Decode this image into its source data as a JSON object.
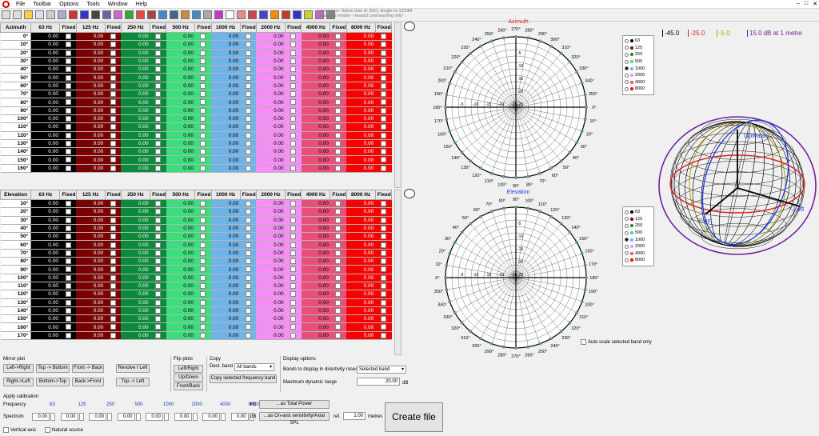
{
  "menu": {
    "items": [
      "File",
      "Toolbar",
      "Options",
      "Tools",
      "Window",
      "Help"
    ],
    "window_buttons": [
      "–",
      "□",
      "✕"
    ]
  },
  "license_text": [
    "Licensed to: Odeon   User id: 2001, dongle no 102084",
    "Restricted version - research and teaching only!"
  ],
  "bands": [
    "63 Hz",
    "125 Hz",
    "250 Hz",
    "500 Hz",
    "1000 Hz",
    "2000 Hz",
    "4000 Hz",
    "8000 Hz"
  ],
  "fixed_label": "Fixed",
  "azimuth_table": {
    "header": "Azimuth",
    "angles": [
      "0°",
      "10°",
      "20°",
      "30°",
      "40°",
      "50°",
      "60°",
      "70°",
      "80°",
      "90°",
      "100°",
      "110°",
      "120°",
      "130°",
      "140°",
      "150°",
      "160°"
    ]
  },
  "elevation_table": {
    "header": "Elevation",
    "angles": [
      "10°",
      "20°",
      "30°",
      "40°",
      "50°",
      "60°",
      "70°",
      "80°",
      "90°",
      "100°",
      "110°",
      "120°",
      "130°",
      "140°",
      "150°",
      "160°",
      "170°"
    ]
  },
  "cell_value": "0.00",
  "azimuth_plot": {
    "title": "Azimuth",
    "title_color": "#e02020",
    "ring_labels": [
      "-5",
      "-10",
      "-15",
      "-20",
      "-25"
    ],
    "angle_labels": [
      "270°",
      "280°",
      "290°",
      "300°",
      "310°",
      "320°",
      "330°",
      "340°",
      "350°",
      "0°",
      "10°",
      "20°",
      "30°",
      "40°",
      "50°",
      "60°",
      "70°",
      "80°",
      "90°",
      "100°",
      "110°",
      "120°",
      "130°",
      "140°",
      "150°",
      "160°",
      "170°",
      "180°",
      "190°",
      "200°",
      "210°",
      "220°",
      "230°",
      "240°",
      "250°",
      "260°"
    ]
  },
  "elevation_plot": {
    "title": "Elevation",
    "title_color": "#2040e0",
    "ring_labels": [
      "-5",
      "-10",
      "-15",
      "-20",
      "-25"
    ],
    "angle_labels": [
      "90°",
      "100°",
      "110°",
      "120°",
      "130°",
      "140°",
      "150°",
      "160°",
      "170°",
      "180°",
      "190°",
      "200°",
      "210°",
      "220°",
      "230°",
      "240°",
      "250°",
      "260°",
      "270°",
      "280°",
      "290°",
      "300°",
      "310°",
      "320°",
      "330°",
      "340°",
      "350°",
      "0°",
      "10°",
      "20°",
      "30°",
      "40°",
      "50°",
      "60°",
      "70°",
      "80°"
    ]
  },
  "radio_bands": {
    "labels": [
      "63",
      "125",
      "250",
      "500",
      "1000",
      "2000",
      "4000",
      "8000"
    ],
    "colors": [
      "#000000",
      "#7a0000",
      "#0a8a3a",
      "#3ddc7c",
      "#6fb4e8",
      "#f58ef5",
      "#e8507a",
      "#f80000"
    ],
    "selected": "1000"
  },
  "scale": {
    "labels": [
      "-45.0",
      "-25.0",
      "-5.0",
      "15.0"
    ],
    "colors": [
      "#000000",
      "#e02020",
      "#b0a000",
      "#7020a0"
    ],
    "unit": "dB at 1 metre"
  },
  "sphere": {
    "labels": [
      "Upwards",
      "Left",
      "Front"
    ]
  },
  "auto_scale": "Auto scale selected band only",
  "mirror": {
    "title": "Mirror plot",
    "buttons": [
      "Left->Right",
      "Top -> Bottom",
      "Front -> Back",
      "Revolve I Left",
      "Right->Left",
      "Bottom->Top",
      "Back->Front",
      "Top -> Left"
    ]
  },
  "flip": {
    "title": "Flip plots",
    "buttons": [
      "Left/Right",
      "Up/Down",
      "Front/Back"
    ]
  },
  "copy": {
    "title": "Copy",
    "dest_label": "Dest. band",
    "dest_value": "All bands",
    "copy_button": "Copy selected frequency band"
  },
  "display": {
    "title": "Display options",
    "bands_label": "Bands to display in directivity roses",
    "bands_value": "Selected band",
    "range_label": "Maximum dynamic range",
    "range_value": "20.00",
    "range_unit": "dB"
  },
  "calibration": {
    "title": "Apply calibration",
    "freq_label": "Frequency",
    "freqs": [
      "63",
      "125",
      "250",
      "500",
      "1000",
      "2000",
      "4000",
      "8000"
    ],
    "hz": "Hz",
    "spectrum_label": "Spectrum",
    "spectrum_values": [
      "0.00",
      "0.00",
      "0.00",
      "0.00",
      "0.00",
      "0.00",
      "0.00",
      "0.00"
    ],
    "db": "dB",
    "total_power": "...as Total Power",
    "on_axis": "...as On-axis sensitivity/Axial SPL",
    "ref_label": "ref.",
    "ref_value": "1.00",
    "metres": "metres",
    "vertical_axis": "Vertical axis",
    "natural_source": "Natural source"
  },
  "create_file": "Create file"
}
